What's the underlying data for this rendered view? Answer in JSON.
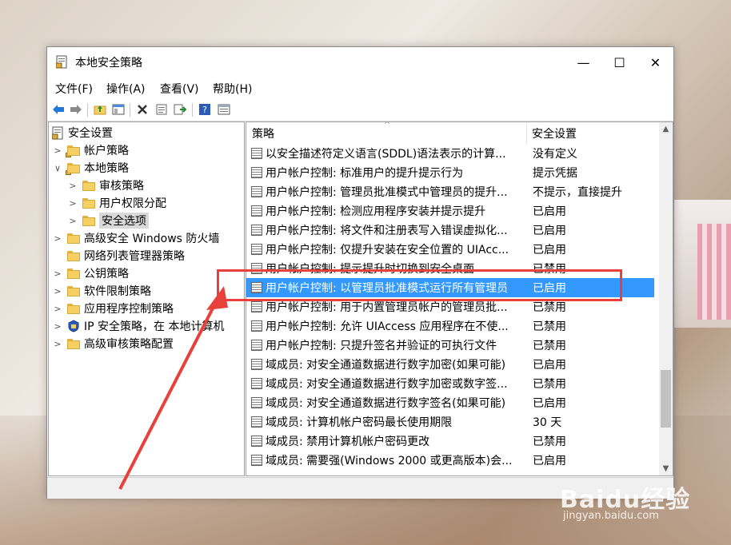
{
  "window": {
    "title": "本地安全策略"
  },
  "titlebar_buttons": {
    "minimize": "—",
    "maximize": "☐",
    "close": "✕"
  },
  "menu": [
    "文件(F)",
    "操作(A)",
    "查看(V)",
    "帮助(H)"
  ],
  "toolbar_icons": [
    "back-icon",
    "forward-icon",
    "up-folder-icon",
    "show-hide-tree-icon",
    "delete-icon",
    "properties-icon",
    "export-icon",
    "help-icon",
    "view-icon"
  ],
  "tree": {
    "root": "安全设置",
    "items": [
      {
        "label": "帐户策略",
        "level": 1,
        "expanded": false
      },
      {
        "label": "本地策略",
        "level": 1,
        "expanded": true
      },
      {
        "label": "审核策略",
        "level": 2,
        "expanded": false
      },
      {
        "label": "用户权限分配",
        "level": 2,
        "expanded": false
      },
      {
        "label": "安全选项",
        "level": 2,
        "expanded": false,
        "selected": true
      },
      {
        "label": "高级安全 Windows 防火墙",
        "level": 1,
        "expanded": false
      },
      {
        "label": "网络列表管理器策略",
        "level": 1,
        "expanded": null
      },
      {
        "label": "公钥策略",
        "level": 1,
        "expanded": false
      },
      {
        "label": "软件限制策略",
        "level": 1,
        "expanded": false
      },
      {
        "label": "应用程序控制策略",
        "level": 1,
        "expanded": false
      },
      {
        "label": "IP 安全策略，在 本地计算机",
        "level": 1,
        "expanded": false
      },
      {
        "label": "高级审核策略配置",
        "level": 1,
        "expanded": false
      }
    ]
  },
  "list": {
    "columns": [
      "策略",
      "安全设置"
    ],
    "rows": [
      {
        "policy": "以安全描述符定义语言(SDDL)语法表示的计算...",
        "setting": "没有定义"
      },
      {
        "policy": "用户帐户控制: 标准用户的提升提示行为",
        "setting": "提示凭据"
      },
      {
        "policy": "用户帐户控制: 管理员批准模式中管理员的提升...",
        "setting": "不提示，直接提升"
      },
      {
        "policy": "用户帐户控制: 检测应用程序安装并提示提升",
        "setting": "已启用"
      },
      {
        "policy": "用户帐户控制: 将文件和注册表写入错误虚拟化...",
        "setting": "已启用"
      },
      {
        "policy": "用户帐户控制: 仅提升安装在安全位置的 UIAcc...",
        "setting": "已启用"
      },
      {
        "policy": "用户帐户控制: 提示提升时切换到安全桌面",
        "setting": "已禁用"
      },
      {
        "policy": "用户帐户控制: 以管理员批准模式运行所有管理员",
        "setting": "已启用",
        "selected": true
      },
      {
        "policy": "用户帐户控制: 用于内置管理员帐户的管理员批...",
        "setting": "已禁用"
      },
      {
        "policy": "用户帐户控制: 允许 UIAccess 应用程序在不使...",
        "setting": "已禁用"
      },
      {
        "policy": "用户帐户控制: 只提升签名并验证的可执行文件",
        "setting": "已禁用"
      },
      {
        "policy": "域成员: 对安全通道数据进行数字加密(如果可能)",
        "setting": "已启用"
      },
      {
        "policy": "域成员: 对安全通道数据进行数字加密或数字签...",
        "setting": "已禁用"
      },
      {
        "policy": "域成员: 对安全通道数据进行数字签名(如果可能)",
        "setting": "已启用"
      },
      {
        "policy": "域成员: 计算机帐户密码最长使用期限",
        "setting": "30 天"
      },
      {
        "policy": "域成员: 禁用计算机帐户密码更改",
        "setting": "已禁用"
      },
      {
        "policy": "域成员: 需要强(Windows 2000 或更高版本)会...",
        "setting": "已启用"
      }
    ]
  },
  "watermark": {
    "logo": "Baidu经验",
    "url": "jingyan.baidu.com"
  },
  "colors": {
    "selection": "#3399ff",
    "annotation": "#e8403a"
  }
}
